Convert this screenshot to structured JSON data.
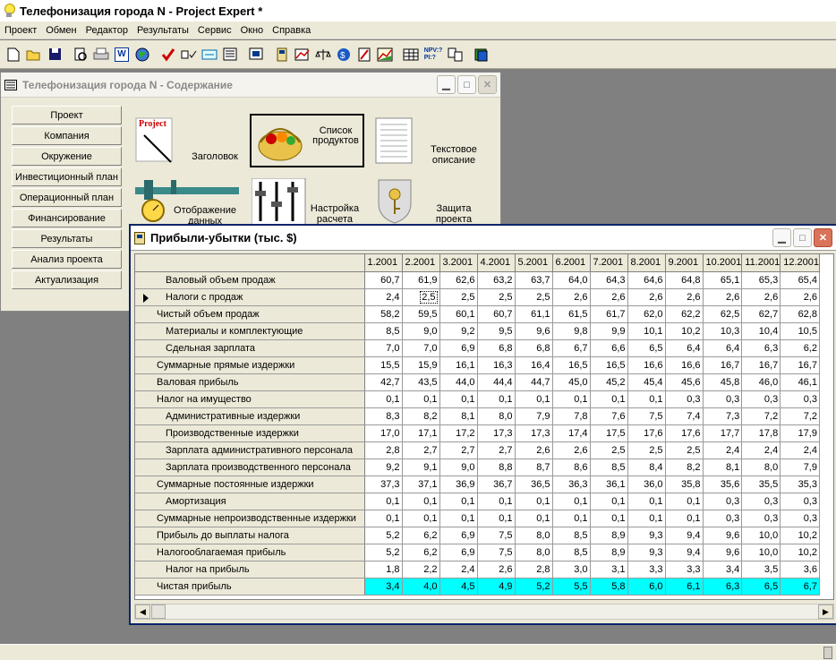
{
  "app": {
    "title": "Телефонизация города N - Project Expert *"
  },
  "menu": [
    "Проект",
    "Обмен",
    "Редактор",
    "Результаты",
    "Сервис",
    "Окно",
    "Справка"
  ],
  "content_window": {
    "title": "Телефонизация города N - Содержание",
    "nav": [
      "Проект",
      "Компания",
      "Окружение",
      "Инвестиционный план",
      "Операционный план",
      "Финансирование",
      "Результаты",
      "Анализ проекта",
      "Актуализация"
    ],
    "items": {
      "title_page": "Заголовок",
      "project_logo": "Project",
      "product_list": "Список\nпродуктов",
      "text_description": "Текстовое\nописание",
      "data_display": "Отображение\nданных",
      "calc_settings": "Настройка\nрасчета",
      "project_protection": "Защита\nпроекта"
    }
  },
  "pl_window": {
    "title": "Прибыли-убытки (тыс. $)",
    "columns": [
      "1.2001",
      "2.2001",
      "3.2001",
      "4.2001",
      "5.2001",
      "6.2001",
      "7.2001",
      "8.2001",
      "9.2001",
      "10.2001",
      "11.2001",
      "12.2001"
    ],
    "rows": [
      {
        "label": "Валовый объем продаж",
        "indent": 1,
        "values": [
          "60,7",
          "61,9",
          "62,6",
          "63,2",
          "63,7",
          "64,0",
          "64,3",
          "64,6",
          "64,8",
          "65,1",
          "65,3",
          "65,4"
        ]
      },
      {
        "label": "Налоги с продаж",
        "indent": 1,
        "marker": true,
        "selected": 1,
        "values": [
          "2,4",
          "2,5",
          "2,5",
          "2,5",
          "2,5",
          "2,6",
          "2,6",
          "2,6",
          "2,6",
          "2,6",
          "2,6",
          "2,6"
        ]
      },
      {
        "label": "Чистый объем продаж",
        "indent": 0,
        "values": [
          "58,2",
          "59,5",
          "60,1",
          "60,7",
          "61,1",
          "61,5",
          "61,7",
          "62,0",
          "62,2",
          "62,5",
          "62,7",
          "62,8"
        ]
      },
      {
        "label": "Материалы и комплектующие",
        "indent": 1,
        "values": [
          "8,5",
          "9,0",
          "9,2",
          "9,5",
          "9,6",
          "9,8",
          "9,9",
          "10,1",
          "10,2",
          "10,3",
          "10,4",
          "10,5"
        ]
      },
      {
        "label": "Сдельная зарплата",
        "indent": 1,
        "values": [
          "7,0",
          "7,0",
          "6,9",
          "6,8",
          "6,8",
          "6,7",
          "6,6",
          "6,5",
          "6,4",
          "6,4",
          "6,3",
          "6,2"
        ]
      },
      {
        "label": "Суммарные прямые издержки",
        "indent": 0,
        "values": [
          "15,5",
          "15,9",
          "16,1",
          "16,3",
          "16,4",
          "16,5",
          "16,5",
          "16,6",
          "16,6",
          "16,7",
          "16,7",
          "16,7"
        ]
      },
      {
        "label": "Валовая прибыль",
        "indent": 0,
        "values": [
          "42,7",
          "43,5",
          "44,0",
          "44,4",
          "44,7",
          "45,0",
          "45,2",
          "45,4",
          "45,6",
          "45,8",
          "46,0",
          "46,1"
        ]
      },
      {
        "label": "Налог на имущество",
        "indent": 0,
        "values": [
          "0,1",
          "0,1",
          "0,1",
          "0,1",
          "0,1",
          "0,1",
          "0,1",
          "0,1",
          "0,3",
          "0,3",
          "0,3",
          "0,3"
        ]
      },
      {
        "label": "Административные издержки",
        "indent": 1,
        "values": [
          "8,3",
          "8,2",
          "8,1",
          "8,0",
          "7,9",
          "7,8",
          "7,6",
          "7,5",
          "7,4",
          "7,3",
          "7,2",
          "7,2"
        ]
      },
      {
        "label": "Производственные издержки",
        "indent": 1,
        "values": [
          "17,0",
          "17,1",
          "17,2",
          "17,3",
          "17,3",
          "17,4",
          "17,5",
          "17,6",
          "17,6",
          "17,7",
          "17,8",
          "17,9"
        ]
      },
      {
        "label": "Зарплата административного персонала",
        "indent": 1,
        "values": [
          "2,8",
          "2,7",
          "2,7",
          "2,7",
          "2,6",
          "2,6",
          "2,5",
          "2,5",
          "2,5",
          "2,4",
          "2,4",
          "2,4"
        ]
      },
      {
        "label": "Зарплата производственного персонала",
        "indent": 1,
        "values": [
          "9,2",
          "9,1",
          "9,0",
          "8,8",
          "8,7",
          "8,6",
          "8,5",
          "8,4",
          "8,2",
          "8,1",
          "8,0",
          "7,9"
        ]
      },
      {
        "label": "Суммарные постоянные издержки",
        "indent": 0,
        "values": [
          "37,3",
          "37,1",
          "36,9",
          "36,7",
          "36,5",
          "36,3",
          "36,1",
          "36,0",
          "35,8",
          "35,6",
          "35,5",
          "35,3"
        ]
      },
      {
        "label": "Амортизация",
        "indent": 1,
        "values": [
          "0,1",
          "0,1",
          "0,1",
          "0,1",
          "0,1",
          "0,1",
          "0,1",
          "0,1",
          "0,1",
          "0,3",
          "0,3",
          "0,3"
        ]
      },
      {
        "label": "Суммарные непроизводственные издержки",
        "indent": 0,
        "values": [
          "0,1",
          "0,1",
          "0,1",
          "0,1",
          "0,1",
          "0,1",
          "0,1",
          "0,1",
          "0,1",
          "0,3",
          "0,3",
          "0,3"
        ]
      },
      {
        "label": "Прибыль до выплаты налога",
        "indent": 0,
        "values": [
          "5,2",
          "6,2",
          "6,9",
          "7,5",
          "8,0",
          "8,5",
          "8,9",
          "9,3",
          "9,4",
          "9,6",
          "10,0",
          "10,2"
        ]
      },
      {
        "label": "Налогооблагаемая прибыль",
        "indent": 0,
        "values": [
          "5,2",
          "6,2",
          "6,9",
          "7,5",
          "8,0",
          "8,5",
          "8,9",
          "9,3",
          "9,4",
          "9,6",
          "10,0",
          "10,2"
        ]
      },
      {
        "label": "Налог на прибыль",
        "indent": 1,
        "values": [
          "1,8",
          "2,2",
          "2,4",
          "2,6",
          "2,8",
          "3,0",
          "3,1",
          "3,3",
          "3,3",
          "3,4",
          "3,5",
          "3,6"
        ]
      },
      {
        "label": "Чистая прибыль",
        "indent": 0,
        "highlight": true,
        "values": [
          "3,4",
          "4,0",
          "4,5",
          "4,9",
          "5,2",
          "5,5",
          "5,8",
          "6,0",
          "6,1",
          "6,3",
          "6,5",
          "6,7"
        ]
      }
    ]
  },
  "toolbar_icons": [
    "new-file-icon",
    "open-folder-icon",
    "save-icon",
    "print-preview-icon",
    "print-icon",
    "word-export-icon",
    "web-icon",
    "check-icon",
    "checklist-icon",
    "link-icon",
    "report-icon",
    "presentation-icon",
    "calculator-icon",
    "cashflow-icon",
    "scales-icon",
    "currency-icon",
    "edit-icon",
    "chart-icon",
    "table-icon",
    "npv-pi-icon",
    "comparison-icon",
    "book-icon"
  ],
  "toolbar_labels": {
    "npv": "NPV:?\nPI:?",
    "word": "W"
  },
  "colors": {
    "highlight_row": "#00ffff",
    "active_title": "#0a246a"
  }
}
